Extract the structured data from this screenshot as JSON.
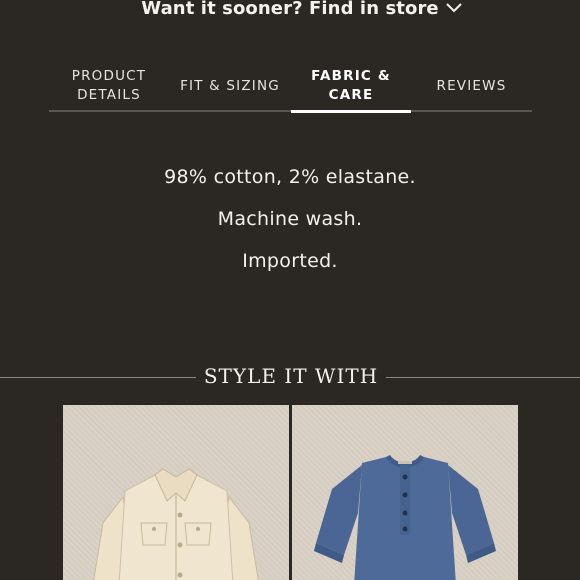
{
  "store_bar": {
    "text": "Want it sooner? Find in store",
    "icon": "chevron-down-icon"
  },
  "tabs": [
    {
      "line1": "PRODUCT",
      "line2": "DETAILS",
      "active": false
    },
    {
      "line1": "FIT & SIZING",
      "line2": "",
      "active": false
    },
    {
      "line1": "FABRIC &",
      "line2": "CARE",
      "active": true
    },
    {
      "line1": "REVIEWS",
      "line2": "",
      "active": false
    }
  ],
  "care": {
    "lines": [
      "98% cotton, 2% elastane.",
      "Machine wash.",
      "Imported."
    ]
  },
  "style_it_with": {
    "title": "STYLE IT WITH",
    "products": [
      {
        "name": "jacket"
      },
      {
        "name": "henley-shirt"
      }
    ]
  },
  "colors": {
    "background": "#2b2824",
    "text": "#f4f1ec",
    "divider": "#5a5651",
    "active_tab": "#ffffff",
    "product_bg": "#d9d1c4",
    "jacket": "#efe4cc",
    "shirt": "#4a6593"
  }
}
